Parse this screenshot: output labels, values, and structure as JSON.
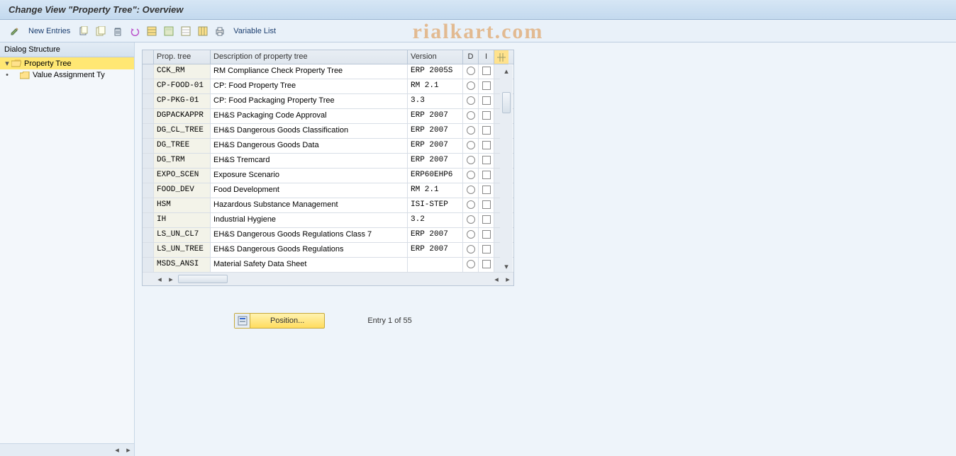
{
  "title": "Change View \"Property Tree\": Overview",
  "watermark": "rialkart.com",
  "toolbar": {
    "new_entries": "New Entries",
    "variable_list": "Variable List"
  },
  "sidebar": {
    "header": "Dialog Structure",
    "root": "Property Tree",
    "child": "Value Assignment Ty"
  },
  "table": {
    "headers": {
      "ptree": "Prop. tree",
      "desc": "Description of property tree",
      "ver": "Version",
      "d": "D",
      "i": "I"
    },
    "rows": [
      {
        "ptree": "CCK_RM",
        "desc": "RM Compliance Check Property Tree",
        "ver": "ERP 2005S"
      },
      {
        "ptree": "CP-FOOD-01",
        "desc": "CP: Food Property Tree",
        "ver": "RM 2.1"
      },
      {
        "ptree": "CP-PKG-01",
        "desc": "CP: Food Packaging Property Tree",
        "ver": "3.3"
      },
      {
        "ptree": "DGPACKAPPR",
        "desc": "EH&S Packaging Code Approval",
        "ver": "ERP 2007"
      },
      {
        "ptree": "DG_CL_TREE",
        "desc": "EH&S Dangerous Goods Classification",
        "ver": "ERP 2007"
      },
      {
        "ptree": "DG_TREE",
        "desc": "EH&S Dangerous Goods Data",
        "ver": "ERP 2007"
      },
      {
        "ptree": "DG_TRM",
        "desc": "EH&S Tremcard",
        "ver": "ERP 2007"
      },
      {
        "ptree": "EXPO_SCEN",
        "desc": "Exposure Scenario",
        "ver": "ERP60EHP6"
      },
      {
        "ptree": "FOOD_DEV",
        "desc": "Food Development",
        "ver": "RM 2.1"
      },
      {
        "ptree": "HSM",
        "desc": "Hazardous Substance Management",
        "ver": "ISI-STEP"
      },
      {
        "ptree": "IH",
        "desc": "Industrial Hygiene",
        "ver": "3.2"
      },
      {
        "ptree": "LS_UN_CL7",
        "desc": "EH&S Dangerous Goods Regulations Class 7",
        "ver": "ERP 2007"
      },
      {
        "ptree": "LS_UN_TREE",
        "desc": "EH&S Dangerous Goods Regulations",
        "ver": "ERP 2007"
      },
      {
        "ptree": "MSDS_ANSI",
        "desc": "Material Safety Data Sheet",
        "ver": ""
      }
    ]
  },
  "footer": {
    "position": "Position...",
    "entry": "Entry 1 of 55"
  }
}
